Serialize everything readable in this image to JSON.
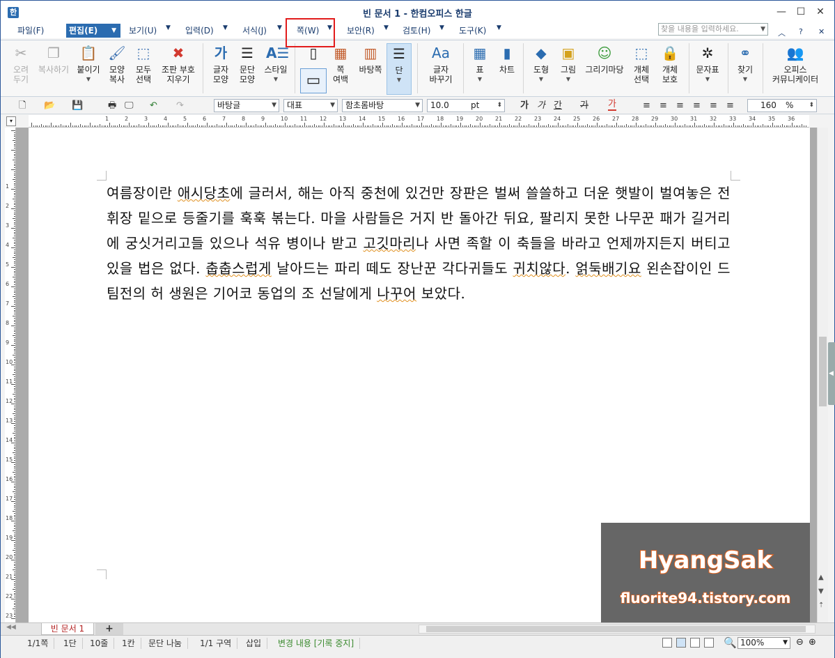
{
  "window": {
    "title": "빈 문서 1 - 한컴오피스 한글",
    "app_icon": "한"
  },
  "menubar": {
    "items": [
      {
        "label": "파일(F)"
      },
      {
        "label": "편집(E)"
      },
      {
        "label": "보기(U)"
      },
      {
        "label": "입력(D)"
      },
      {
        "label": "서식(J)"
      },
      {
        "label": "쪽(W)"
      },
      {
        "label": "보안(R)"
      },
      {
        "label": "검토(H)"
      },
      {
        "label": "도구(K)"
      }
    ],
    "search_placeholder": "찾을 내용을 입력하세요."
  },
  "ribbon": {
    "cut": "오려\n두기",
    "copy": "복사하기",
    "paste": "붙이기",
    "format_copy": "모양\n복사",
    "select_all": "모두\n선택",
    "clear_codes": "조판 부호\n지우기",
    "char_shape": "글자\n모양",
    "para_shape": "문단\n모양",
    "style": "스타일",
    "page_margin": "쪽\n여백",
    "master_page": "바탕쪽",
    "column": "단",
    "replace_char": "글자\n바꾸기",
    "table": "표",
    "chart": "차트",
    "shape": "도형",
    "picture": "그림",
    "draw_mart": "그리기마당",
    "object_select": "개체\n선택",
    "object_protect": "개체\n보호",
    "symbols": "문자표",
    "find": "찾기",
    "office_communicator": "오피스\n커뮤니케이터"
  },
  "format_toolbar": {
    "style_name": "바탕글",
    "lang": "대표",
    "font": "함초롬바탕",
    "font_size": "10.0",
    "font_unit": "pt",
    "line_spacing": "160",
    "line_spacing_unit": "%",
    "bold": "가",
    "italic": "가",
    "underline": "간",
    "strike": "가",
    "color": "가"
  },
  "document": {
    "paragraph_parts": [
      {
        "t": "여름장이란 ",
        "sq": false
      },
      {
        "t": "애시당초",
        "sq": true
      },
      {
        "t": "에 글러서, 해는 아직 중천에 있건만 장판은 벌써 쓸쓸하고 더운 햇발이 벌여놓은 전 휘장 밑으로 등줄기를 훅훅 볶는다. 마을 사람들은 거지 반 돌아간 뒤요, 팔리지 못한 나무꾼 패가 길거리에 궁싯거리고들 있으나 석유 병이나 받고 ",
        "sq": false
      },
      {
        "t": "고깃마리",
        "sq": true
      },
      {
        "t": "나 사면 족할 이 축들을 바라고 언제까지든지 버티고 있을 법은 없다. ",
        "sq": false
      },
      {
        "t": "춥춥스럽게",
        "sq": true
      },
      {
        "t": " 날아드는 파리 떼도 장난꾼 각다귀들도 ",
        "sq": false
      },
      {
        "t": "귀치않다",
        "sq": true
      },
      {
        "t": ". ",
        "sq": false
      },
      {
        "t": "얽둑배기요",
        "sq": true
      },
      {
        "t": " 왼손잡이인 드팀전의 허 생원은 기어코 동업의 조 선달에게 ",
        "sq": false
      },
      {
        "t": "나꾸어",
        "sq": true
      },
      {
        "t": " 보았다.",
        "sq": false
      }
    ]
  },
  "watermark": {
    "name": "HyangSak",
    "url": "fluorite94.tistory.com"
  },
  "tabs": {
    "doc_tab": "빈 문서 1",
    "add": "+"
  },
  "statusbar": {
    "page": "1/1쪽",
    "column": "1단",
    "line": "10줄",
    "col": "1칸",
    "break": "문단 나눔",
    "section": "1/1 구역",
    "insert": "삽입",
    "track": "변경 내용 [기록 중지]",
    "zoom": "100%"
  },
  "colors": {
    "accent": "#2b6cb0",
    "highlight": "#e21b1b",
    "brand_orange": "#e8621a"
  }
}
